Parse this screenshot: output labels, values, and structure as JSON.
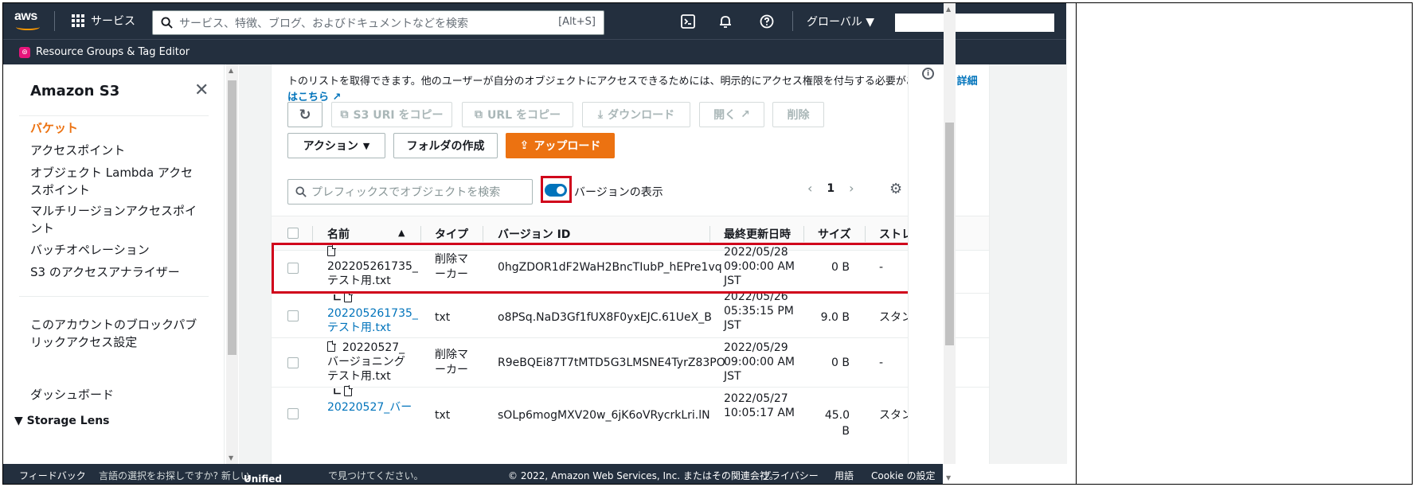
{
  "topnav": {
    "logo_text": "aws",
    "services_label": "サービス",
    "search_placeholder": "サービス、特徴、ブログ、およびドキュメントなどを検索",
    "search_shortcut": "[Alt+S]",
    "region_label": "グローバル ▼"
  },
  "subnav": {
    "resource_groups_label": "Resource Groups & Tag Editor"
  },
  "sidebar": {
    "title": "Amazon S3",
    "items": [
      {
        "label": "バケット",
        "active": true
      },
      {
        "label": "アクセスポイント"
      },
      {
        "label": "オブジェクト Lambda アクセスポイント"
      },
      {
        "label": "マルチリージョンアクセスポイント"
      },
      {
        "label": "バッチオペレーション"
      },
      {
        "label": "S3 のアクセスアナライザー"
      }
    ],
    "block_public_access": "このアカウントのブロックパブリックアクセス設定",
    "storage_lens": "Storage Lens",
    "dashboard": "ダッシュボード"
  },
  "main": {
    "description": "トのリストを取得できます。他のユーザーが自分のオブジェクトにアクセスできるためには、明示的にアクセス権限を付与する必要があります。",
    "details_link": "詳細はこちら",
    "toolbar": {
      "copy_s3_uri": "S3 URI をコピー",
      "copy_url": "URL をコピー",
      "download": "ダウンロード",
      "open": "開く",
      "delete": "削除",
      "actions": "アクション",
      "create_folder": "フォルダの作成",
      "upload": "アップロード"
    },
    "filter_placeholder": "プレフィックスでオブジェクトを検索",
    "show_versions_label": "バージョンの表示",
    "page_number": "1"
  },
  "table": {
    "columns": [
      "名前",
      "タイプ",
      "バージョン ID",
      "最終更新日時",
      "サイズ",
      "ストレ"
    ],
    "rows": [
      {
        "name_line1": "202205261735_",
        "name_line2": "テスト用.txt",
        "type_line1": "削除マ",
        "type_line2": "ーカー",
        "version_id": "0hgZDOR1dF2WaH2BncTIubP_hEPre1vq",
        "date_line1": "2022/05/28",
        "date_line2": "09:00:00 AM",
        "date_line3": "JST",
        "size": "0 B",
        "storage": "-"
      },
      {
        "name_line1": "202205261735_",
        "name_line2": "テスト用.txt",
        "type_line1": "txt",
        "type_line2": "",
        "version_id": "o8PSq.NaD3Gf1fUX8F0yxEJC.61UeX_B",
        "date_line1": "2022/05/26",
        "date_line2": "05:35:15 PM",
        "date_line3": "JST",
        "size": "9.0 B",
        "storage": "スタン"
      },
      {
        "name_line1": "20220527_",
        "name_line2": "バージョニング",
        "name_line3": "テスト用.txt",
        "type_line1": "削除マ",
        "type_line2": "ーカー",
        "version_id": "R9eBQEi87T7tMTD5G3LMSNE4TyrZ83PO",
        "date_line1": "2022/05/29",
        "date_line2": "09:00:00 AM",
        "date_line3": "JST",
        "size": "0 B",
        "storage": "-"
      },
      {
        "name_line1": "20220527_バー",
        "type_line1": "txt",
        "version_id": "sOLp6mogMXV20w_6jK6oVRycrkLri.lN",
        "date_line1": "2022/05/27",
        "date_line2": "10:05:17 AM",
        "size": "45.0 B",
        "storage": "スタン"
      }
    ]
  },
  "footer": {
    "feedback": "フィードバック",
    "language_prompt": "言語の選択をお探しですか? 新しい",
    "unified_settings": "Unified Settings",
    "language_suffix": "で見つけてください。",
    "copyright": "© 2022, Amazon Web Services, Inc. またはその関連会社。",
    "privacy": "プライバシー",
    "terms": "用語",
    "cookie": "Cookie の設定"
  },
  "colors": {
    "nav_bg": "#232f3e",
    "accent_orange": "#ec7211",
    "link_blue": "#0073bb",
    "highlight_red": "#d0021b"
  }
}
